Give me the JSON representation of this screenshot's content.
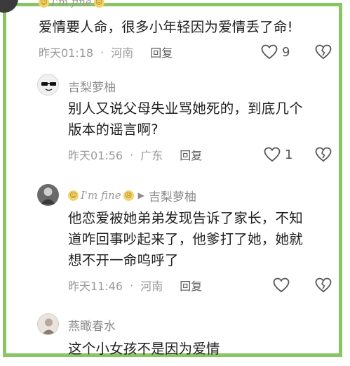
{
  "comments": [
    {
      "user_flair": "I'm fine",
      "text_lines": [
        "爱情要人命，很多小年轻因为爱情丢了命!"
      ],
      "time": "昨天01:18",
      "location": "河南",
      "reply_label": "回复",
      "likes": "9"
    },
    {
      "user": "吉梨萝柚",
      "text_lines": [
        "别人又说父母失业骂她死的，到底几个",
        "版本的谣言啊?"
      ],
      "time": "昨天01:56",
      "location": "广东",
      "reply_label": "回复",
      "likes": "1"
    },
    {
      "user_flair": "I'm fine",
      "reply_to": "吉梨萝柚",
      "text_lines": [
        "他恋爱被她弟弟发现告诉了家长，不知",
        "道咋回事吵起来了，他爹打了她，她就",
        "想不开一命呜呼了"
      ],
      "time": "昨天11:46",
      "location": "河南",
      "reply_label": "回复",
      "likes": ""
    },
    {
      "user": "燕瞰春水",
      "text_lines": [
        "这个小女孩不是因为爱情"
      ]
    }
  ],
  "colors": {
    "frame": "#8ac463",
    "meta": "#9a9a9a",
    "text": "#1f1f1f"
  },
  "icons": {
    "like": "heart-outline-icon",
    "dislike": "broken-heart-icon"
  }
}
